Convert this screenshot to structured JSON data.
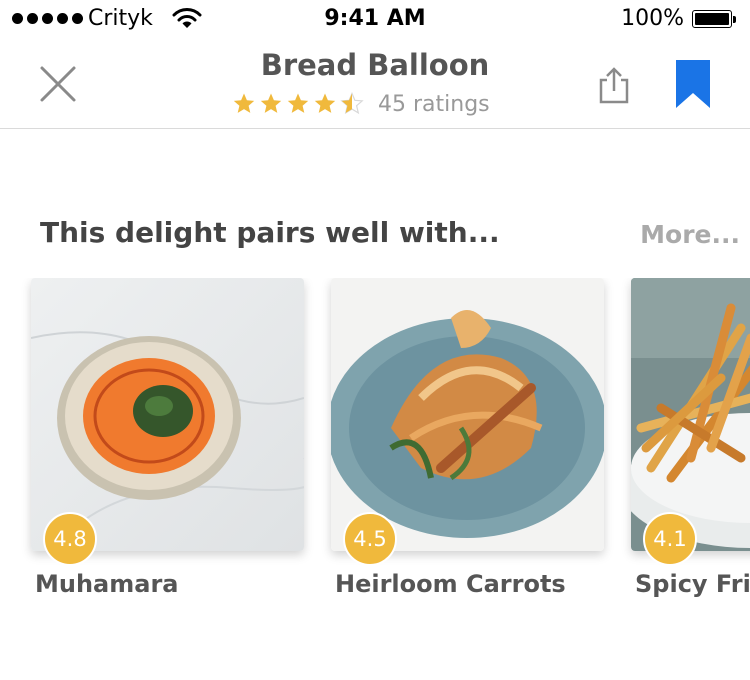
{
  "status_bar": {
    "carrier": "Crityk",
    "time": "9:41 AM",
    "battery": "100%"
  },
  "header": {
    "title": "Bread Balloon",
    "rating": 4.5,
    "max_rating": 5,
    "ratings_label": "45 ratings",
    "icons": {
      "close": "close-icon",
      "share": "share-icon",
      "bookmark": "bookmark-icon"
    }
  },
  "colors": {
    "star": "#f0b93c",
    "badge": "#f0b93c",
    "bookmark": "#1a74e6"
  },
  "section": {
    "title": "This delight pairs well with...",
    "more": "More..."
  },
  "dishes": [
    {
      "name": "Muhamara",
      "rating": "4.8"
    },
    {
      "name": "Heirloom Carrots",
      "rating": "4.5"
    },
    {
      "name": "Spicy Fries",
      "rating": "4.1"
    }
  ]
}
